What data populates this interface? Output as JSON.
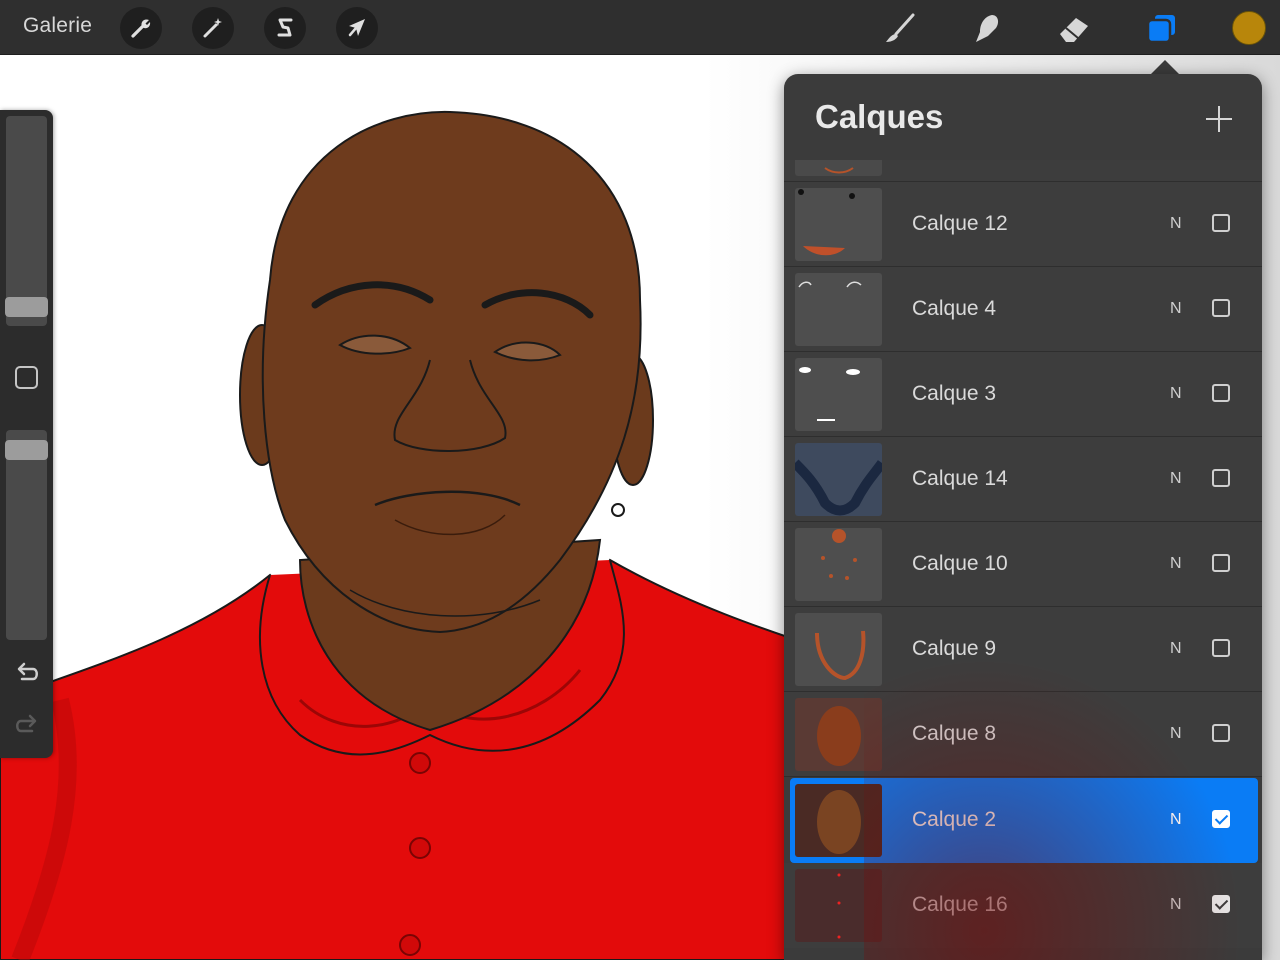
{
  "app": {
    "gallery_label": "Galerie",
    "accent_color": "#0a7cf5",
    "current_color": "#b8860b"
  },
  "toolbar": {
    "left_tools": [
      {
        "name": "actions",
        "icon": "wrench-icon"
      },
      {
        "name": "adjustments",
        "icon": "magic-wand-icon"
      },
      {
        "name": "selection",
        "icon": "selection-s-icon"
      },
      {
        "name": "transform",
        "icon": "arrow-cursor-icon"
      }
    ],
    "right_tools": [
      {
        "name": "brush",
        "icon": "brush-icon"
      },
      {
        "name": "smudge",
        "icon": "smudge-finger-icon"
      },
      {
        "name": "eraser",
        "icon": "eraser-icon"
      },
      {
        "name": "layers",
        "icon": "layers-icon",
        "active": true
      }
    ]
  },
  "sidebar": {
    "brush_size_level": 0.05,
    "opacity_level": 0.95,
    "undo_icon": "undo-icon",
    "redo_icon": "redo-icon"
  },
  "layers_panel": {
    "title": "Calques",
    "add_icon": "plus-icon",
    "layers": [
      {
        "name": "Calque 12",
        "blend": "N",
        "visible": false,
        "selected": false
      },
      {
        "name": "Calque 4",
        "blend": "N",
        "visible": false,
        "selected": false
      },
      {
        "name": "Calque 3",
        "blend": "N",
        "visible": false,
        "selected": false
      },
      {
        "name": "Calque 14",
        "blend": "N",
        "visible": false,
        "selected": false
      },
      {
        "name": "Calque 10",
        "blend": "N",
        "visible": false,
        "selected": false
      },
      {
        "name": "Calque 9",
        "blend": "N",
        "visible": false,
        "selected": false
      },
      {
        "name": "Calque 8",
        "blend": "N",
        "visible": false,
        "selected": false
      },
      {
        "name": "Calque 2",
        "blend": "N",
        "visible": true,
        "selected": true
      },
      {
        "name": "Calque 16",
        "blend": "N",
        "visible": true,
        "selected": false
      }
    ]
  }
}
